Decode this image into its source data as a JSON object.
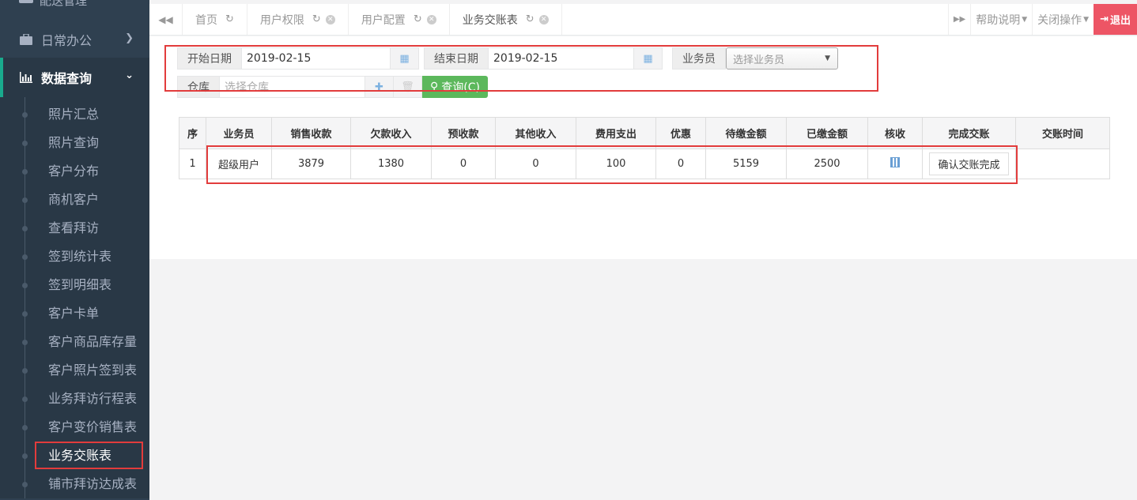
{
  "sidebar": {
    "top_partial_label": "配送管理",
    "menus": [
      {
        "label": "日常办公",
        "icon": "briefcase-icon"
      },
      {
        "label": "数据查询",
        "icon": "bar-chart-icon"
      }
    ],
    "sub_items": [
      "照片汇总",
      "照片查询",
      "客户分布",
      "商机客户",
      "查看拜访",
      "签到统计表",
      "签到明细表",
      "客户卡单",
      "客户商品库存量",
      "客户照片签到表",
      "业务拜访行程表",
      "客户变价销售表",
      "业务交账表",
      "铺市拜访达成表"
    ]
  },
  "tabs": {
    "items": [
      {
        "label": "首页"
      },
      {
        "label": "用户权限"
      },
      {
        "label": "用户配置"
      },
      {
        "label": "业务交账表"
      }
    ],
    "help_label": "帮助说明",
    "close_ops_label": "关闭操作",
    "logout_label": "退出"
  },
  "filters": {
    "start_date_label": "开始日期",
    "start_date_value": "2019-02-15",
    "end_date_label": "结束日期",
    "end_date_value": "2019-02-15",
    "salesman_label": "业务员",
    "salesman_placeholder": "选择业务员",
    "warehouse_label": "仓库",
    "warehouse_placeholder": "选择仓库",
    "query_label": "查询(C)"
  },
  "table": {
    "headers": [
      "序",
      "业务员",
      "销售收款",
      "欠款收入",
      "预收款",
      "其他收入",
      "费用支出",
      "优惠",
      "待缴金额",
      "已缴金额",
      "核收",
      "完成交账",
      "交账时间"
    ],
    "rows": [
      {
        "index": "1",
        "salesman": "超级用户",
        "sales_receipt": "3879",
        "debt_income": "1380",
        "advance": "0",
        "other_income": "0",
        "expense": "100",
        "discount": "0",
        "pending": "5159",
        "paid": "2500",
        "confirm_label": "确认交账完成",
        "time": ""
      }
    ]
  }
}
